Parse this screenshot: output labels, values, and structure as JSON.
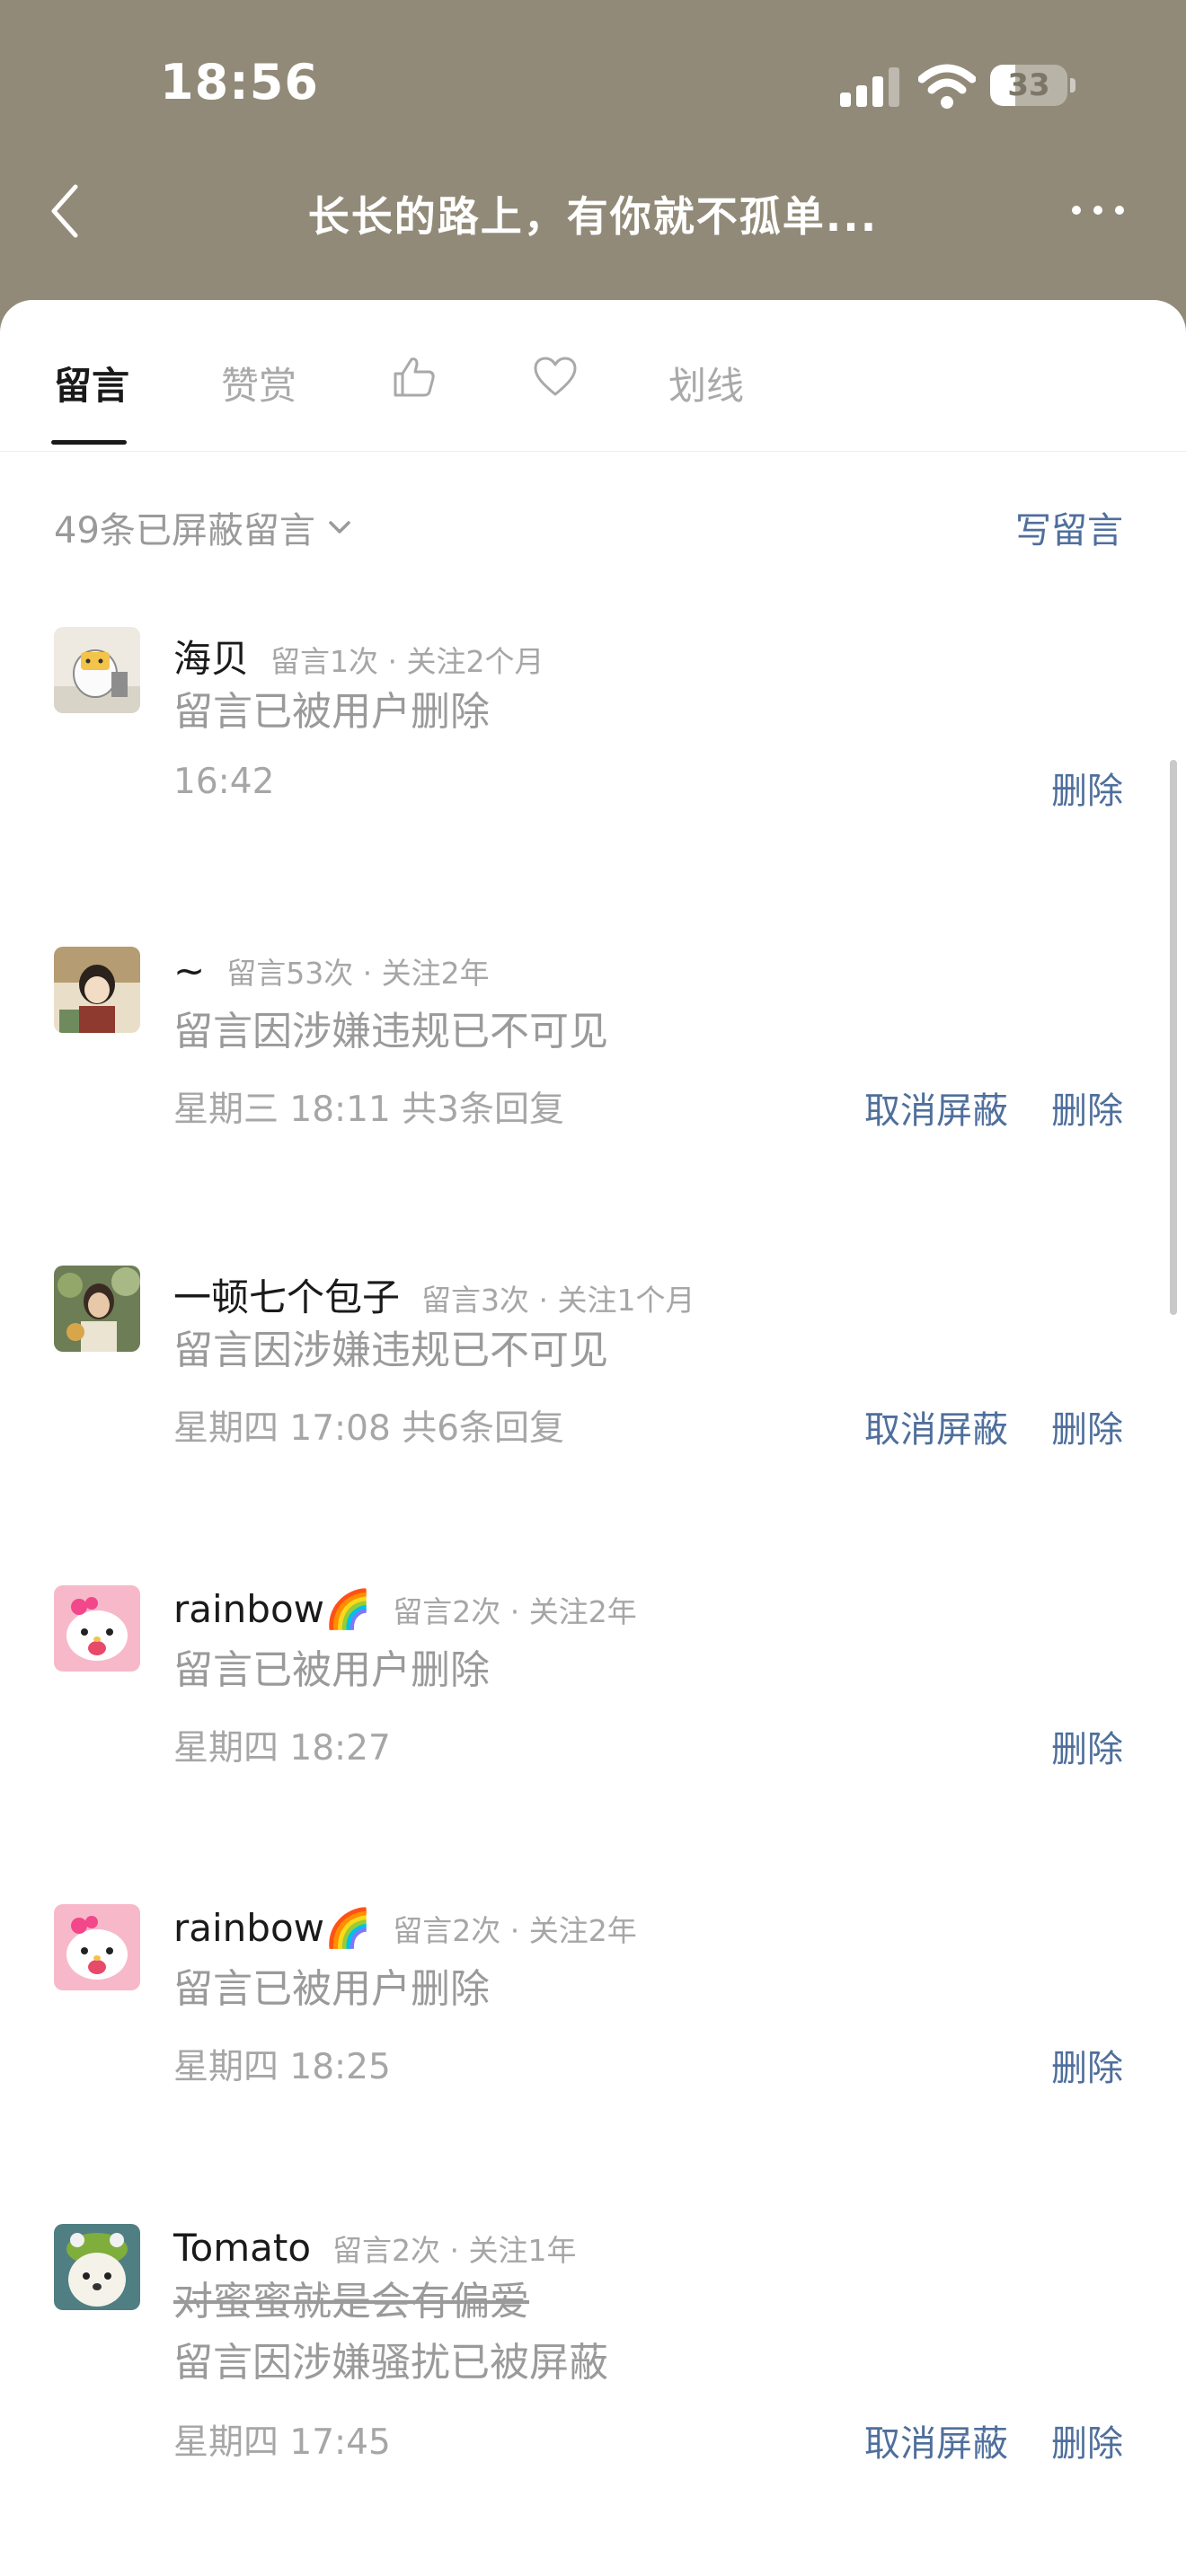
{
  "status_bar": {
    "time": "18:56",
    "battery_level": "33",
    "battery_fraction": 0.33
  },
  "nav": {
    "title": "长长的路上，有你就不孤单..."
  },
  "tabs": [
    {
      "label": "留言",
      "active": true
    },
    {
      "label": "赞赏",
      "active": false
    },
    {
      "label": "",
      "icon": "thumbs-up-icon",
      "active": false
    },
    {
      "label": "",
      "icon": "heart-icon",
      "active": false
    },
    {
      "label": "划线",
      "active": false
    }
  ],
  "toolbar": {
    "blocked_label": "49条已屏蔽留言",
    "write_label": "写留言"
  },
  "comments": [
    {
      "name": "海贝",
      "meta": "留言1次 · 关注2个月",
      "content": "留言已被用户删除",
      "footer": "16:42",
      "unblock_label": "",
      "delete_label": "删除"
    },
    {
      "name": "~",
      "meta": "留言53次 · 关注2年",
      "content": "留言因涉嫌违规已不可见",
      "footer": "星期三 18:11 共3条回复",
      "unblock_label": "取消屏蔽",
      "delete_label": "删除"
    },
    {
      "name": "一顿七个包子",
      "meta": "留言3次 · 关注1个月",
      "content": "留言因涉嫌违规已不可见",
      "footer": "星期四 17:08 共6条回复",
      "unblock_label": "取消屏蔽",
      "delete_label": "删除"
    },
    {
      "name": "rainbow🌈",
      "meta": "留言2次 · 关注2年",
      "content": "留言已被用户删除",
      "footer": "星期四 18:27",
      "unblock_label": "",
      "delete_label": "删除"
    },
    {
      "name": "rainbow🌈",
      "meta": "留言2次 · 关注2年",
      "content": "留言已被用户删除",
      "footer": "星期四 18:25",
      "unblock_label": "",
      "delete_label": "删除"
    },
    {
      "name": "Tomato",
      "meta": "留言2次 · 关注1年",
      "struck_text": "对蜜蜜就是会有偏爱",
      "content": "留言因涉嫌骚扰已被屏蔽",
      "footer": "星期四 17:45",
      "unblock_label": "取消屏蔽",
      "delete_label": "删除"
    }
  ]
}
